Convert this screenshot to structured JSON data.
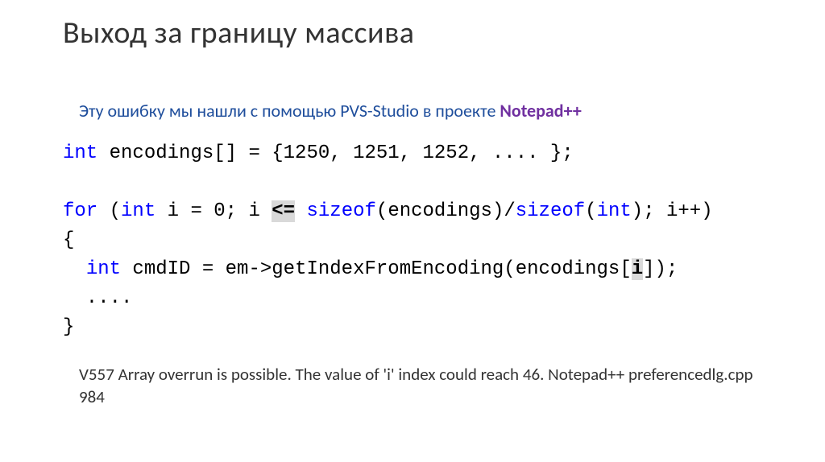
{
  "title": "Выход за границу массива",
  "subtitle": {
    "prefix": "Эту ошибку мы нашли с помощью PVS-Studio в проекте ",
    "project": "Notepad++"
  },
  "code": {
    "line1_kw": "int",
    "line1_rest": " encodings[] = {1250, 1251, 1252, .... };",
    "line2_for": "for",
    "line2_a": " (",
    "line2_int": "int",
    "line2_b": " i = 0; i ",
    "line2_op": "<=",
    "line2_c": " ",
    "line2_sizeof1": "sizeof",
    "line2_d": "(encodings)/",
    "line2_sizeof2": "sizeof",
    "line2_e": "(",
    "line2_int2": "int",
    "line2_f": "); i++)",
    "line3": "{",
    "line4_a": "  ",
    "line4_int": "int",
    "line4_b": " cmdID = em->getIndexFromEncoding(encodings[",
    "line4_var": "i",
    "line4_c": "]);",
    "line5": "  ....",
    "line6": "}"
  },
  "diagnostic": "V557 Array overrun is possible. The value of 'i' index could reach 46.  Notepad++ preferencedlg.cpp  984"
}
